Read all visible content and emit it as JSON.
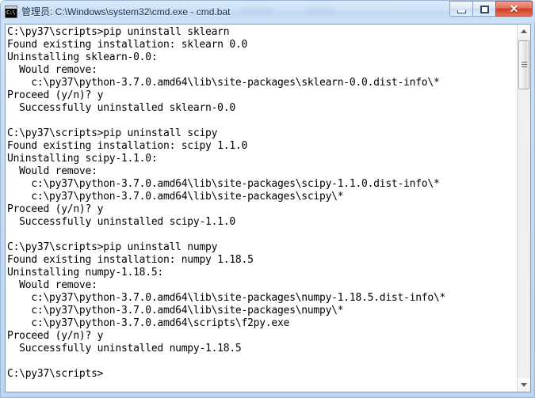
{
  "window": {
    "title": "管理员: C:\\Windows\\system32\\cmd.exe - cmd.bat",
    "icon": "cmd-console-icon",
    "icon_glyph": "C:\\",
    "controls": {
      "minimize_label": "–",
      "maximize_label": "□",
      "close_label": "✕"
    },
    "colors": {
      "frame": "#c6dcf3",
      "title_text": "#13304e",
      "close_button": "#cf3d22",
      "console_background": "#ffffff",
      "console_text": "#000000"
    }
  },
  "console": {
    "prompt": "C:\\py37\\scripts>",
    "text": "C:\\py37\\scripts>pip uninstall sklearn\nFound existing installation: sklearn 0.0\nUninstalling sklearn-0.0:\n  Would remove:\n    c:\\py37\\python-3.7.0.amd64\\lib\\site-packages\\sklearn-0.0.dist-info\\*\nProceed (y/n)? y\n  Successfully uninstalled sklearn-0.0\n\nC:\\py37\\scripts>pip uninstall scipy\nFound existing installation: scipy 1.1.0\nUninstalling scipy-1.1.0:\n  Would remove:\n    c:\\py37\\python-3.7.0.amd64\\lib\\site-packages\\scipy-1.1.0.dist-info\\*\n    c:\\py37\\python-3.7.0.amd64\\lib\\site-packages\\scipy\\*\nProceed (y/n)? y\n  Successfully uninstalled scipy-1.1.0\n\nC:\\py37\\scripts>pip uninstall numpy\nFound existing installation: numpy 1.18.5\nUninstalling numpy-1.18.5:\n  Would remove:\n    c:\\py37\\python-3.7.0.amd64\\lib\\site-packages\\numpy-1.18.5.dist-info\\*\n    c:\\py37\\python-3.7.0.amd64\\lib\\site-packages\\numpy\\*\n    c:\\py37\\python-3.7.0.amd64\\scripts\\f2py.exe\nProceed (y/n)? y\n  Successfully uninstalled numpy-1.18.5\n\nC:\\py37\\scripts>",
    "sessions": [
      {
        "command": "pip uninstall sklearn",
        "found": "Found existing installation: sklearn 0.0",
        "uninstalling": "Uninstalling sklearn-0.0:",
        "would_remove_label": "Would remove:",
        "paths": [
          "c:\\py37\\python-3.7.0.amd64\\lib\\site-packages\\sklearn-0.0.dist-info\\*"
        ],
        "prompt": "Proceed (y/n)? y",
        "result": "Successfully uninstalled sklearn-0.0"
      },
      {
        "command": "pip uninstall scipy",
        "found": "Found existing installation: scipy 1.1.0",
        "uninstalling": "Uninstalling scipy-1.1.0:",
        "would_remove_label": "Would remove:",
        "paths": [
          "c:\\py37\\python-3.7.0.amd64\\lib\\site-packages\\scipy-1.1.0.dist-info\\*",
          "c:\\py37\\python-3.7.0.amd64\\lib\\site-packages\\scipy\\*"
        ],
        "prompt": "Proceed (y/n)? y",
        "result": "Successfully uninstalled scipy-1.1.0"
      },
      {
        "command": "pip uninstall numpy",
        "found": "Found existing installation: numpy 1.18.5",
        "uninstalling": "Uninstalling numpy-1.18.5:",
        "would_remove_label": "Would remove:",
        "paths": [
          "c:\\py37\\python-3.7.0.amd64\\lib\\site-packages\\numpy-1.18.5.dist-info\\*",
          "c:\\py37\\python-3.7.0.amd64\\lib\\site-packages\\numpy\\*",
          "c:\\py37\\python-3.7.0.amd64\\scripts\\f2py.exe"
        ],
        "prompt": "Proceed (y/n)? y",
        "result": "Successfully uninstalled numpy-1.18.5"
      }
    ]
  },
  "scrollbar": {
    "up_arrow": "scroll-up-icon",
    "down_arrow": "scroll-down-icon",
    "thumb": "scroll-thumb"
  }
}
